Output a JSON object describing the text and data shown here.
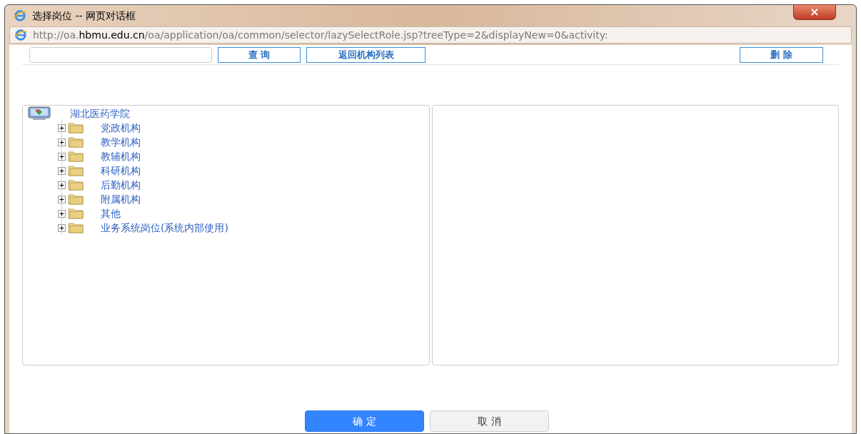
{
  "window": {
    "title": "选择岗位 -- 网页对话框",
    "close": "×"
  },
  "address_bar": {
    "url_prefix": "http://oa.",
    "url_domain": "hbmu.edu.cn",
    "url_rest": "/oa/application/oa/common/selector/lazySelectRole.jsp?treeType=2&displayNew=0&activity:"
  },
  "toolbar": {
    "query_button": "查 询",
    "back_button": "返回机构列表",
    "delete_button": "删 除"
  },
  "tree": {
    "root": {
      "label": "湖北医药学院",
      "expanded": true,
      "children": [
        {
          "label": "党政机构",
          "expanded": false
        },
        {
          "label": "教学机构",
          "expanded": false
        },
        {
          "label": "教辅机构",
          "expanded": false
        },
        {
          "label": "科研机构",
          "expanded": false
        },
        {
          "label": "后勤机构",
          "expanded": false
        },
        {
          "label": "附属机构",
          "expanded": false
        },
        {
          "label": "其他",
          "expanded": false
        },
        {
          "label": "业务系统岗位(系统内部使用)",
          "expanded": false
        }
      ]
    }
  },
  "buttons": [
    {
      "label": "确 定",
      "kind": "primary"
    },
    {
      "label": "取 消",
      "kind": "secondary"
    }
  ]
}
